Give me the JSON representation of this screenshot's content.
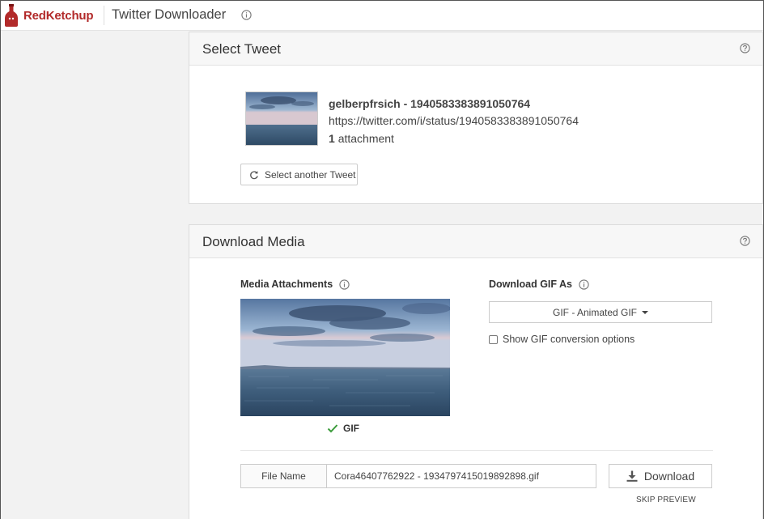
{
  "header": {
    "logo_text": "RedKetchup",
    "app_title": "Twitter Downloader",
    "brand_color": "#b22a2a"
  },
  "select_tweet": {
    "title": "Select Tweet",
    "tweet_user": "gelberpfrsich - 1940583383891050764",
    "tweet_url": "https://twitter.com/i/status/1940583383891050764",
    "attachment_count": "1",
    "attachment_word": "attachment",
    "select_another_label": "Select another Tweet"
  },
  "download_media": {
    "title": "Download Media",
    "media_attachments_label": "Media Attachments",
    "download_as_label": "Download GIF As",
    "format_selected": "GIF - Animated GIF",
    "gif_badge": "GIF",
    "show_options_label": "Show GIF conversion options",
    "show_options_checked": false,
    "file_name_label": "File Name",
    "file_name_value": "Cora46407762922 - 1934797415019892898.gif",
    "download_label": "Download",
    "skip_preview_label": "SKIP PREVIEW",
    "check_color": "#3a9b3a"
  },
  "icons": {
    "header_info": "info-icon",
    "panel_help": "help-icon",
    "refresh": "refresh-icon",
    "download": "download-icon",
    "check": "check-icon"
  }
}
